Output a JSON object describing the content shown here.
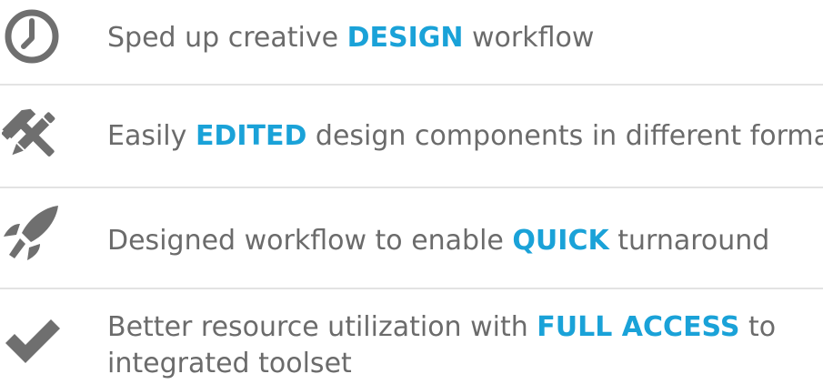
{
  "colors": {
    "text": "#6b6b6b",
    "highlight": "#1aa2d8",
    "icon": "#6f6f6f",
    "divider": "#e3e3e3"
  },
  "features": [
    {
      "icon": "clock-icon",
      "before": "Sped up creative ",
      "highlight": "DESIGN",
      "after": " workflow"
    },
    {
      "icon": "hammer-pencil-icon",
      "before": "Easily ",
      "highlight": "EDITED",
      "after": " design components in different formats"
    },
    {
      "icon": "rocket-icon",
      "before": "Designed workflow to enable ",
      "highlight": "QUICK",
      "after": " turnaround"
    },
    {
      "icon": "checkmark-icon",
      "before": "Better resource utilization with ",
      "highlight": "FULL ACCESS",
      "after": " to integrated toolset"
    }
  ]
}
